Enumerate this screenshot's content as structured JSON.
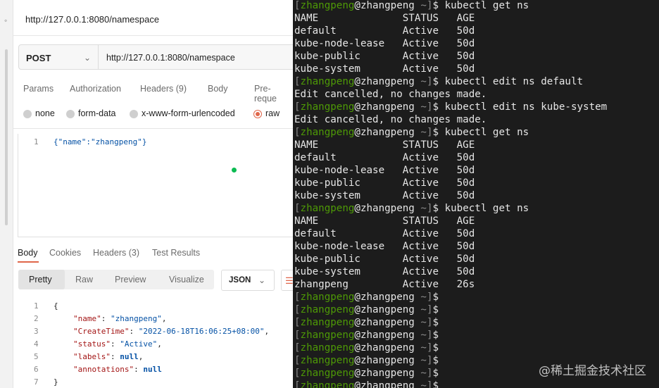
{
  "request": {
    "title": "http://127.0.0.1:8080/namespace",
    "method": "POST",
    "url": "http://127.0.0.1:8080/namespace",
    "tabs": {
      "params": "Params",
      "authorization": "Authorization",
      "headers": "Headers",
      "headers_count": "(9)",
      "body": "Body",
      "prerequest": "Pre-reque"
    },
    "body_types": [
      "none",
      "form-data",
      "x-www-form-urlencoded",
      "raw"
    ],
    "body_line": "1",
    "body_text": "{\"name\":\"zhangpeng\"}"
  },
  "response": {
    "tabs": {
      "body": "Body",
      "cookies": "Cookies",
      "headers": "Headers",
      "headers_count": "(3)",
      "tests": "Test Results"
    },
    "views": [
      "Pretty",
      "Raw",
      "Preview",
      "Visualize"
    ],
    "format": "JSON",
    "lines": [
      "1",
      "2",
      "3",
      "4",
      "5",
      "6",
      "7"
    ],
    "json": {
      "open": "{",
      "name_key": "\"name\"",
      "name_val": "\"zhangpeng\"",
      "create_key": "\"CreateTime\"",
      "create_val": "\"2022-06-18T16:06:25+08:00\"",
      "status_key": "\"status\"",
      "status_val": "\"Active\"",
      "labels_key": "\"labels\"",
      "labels_val": "null",
      "ann_key": "\"annotations\"",
      "ann_val": "null",
      "close": "}"
    }
  },
  "terminal": {
    "user": "zhangpeng",
    "host": "zhangpeng",
    "cwd": "~",
    "lines": [
      {
        "type": "prompt",
        "cmd": "kubectl get ns"
      },
      {
        "type": "out",
        "text": "NAME              STATUS   AGE"
      },
      {
        "type": "out",
        "text": "default           Active   50d"
      },
      {
        "type": "out",
        "text": "kube-node-lease   Active   50d"
      },
      {
        "type": "out",
        "text": "kube-public       Active   50d"
      },
      {
        "type": "out",
        "text": "kube-system       Active   50d"
      },
      {
        "type": "prompt",
        "cmd": "kubectl edit ns default"
      },
      {
        "type": "out",
        "text": "Edit cancelled, no changes made."
      },
      {
        "type": "prompt",
        "cmd": "kubectl edit ns kube-system"
      },
      {
        "type": "out",
        "text": "Edit cancelled, no changes made."
      },
      {
        "type": "prompt",
        "cmd": "kubectl get ns"
      },
      {
        "type": "out",
        "text": "NAME              STATUS   AGE"
      },
      {
        "type": "out",
        "text": "default           Active   50d"
      },
      {
        "type": "out",
        "text": "kube-node-lease   Active   50d"
      },
      {
        "type": "out",
        "text": "kube-public       Active   50d"
      },
      {
        "type": "out",
        "text": "kube-system       Active   50d"
      },
      {
        "type": "prompt",
        "cmd": "kubectl get ns"
      },
      {
        "type": "out",
        "text": "NAME              STATUS   AGE"
      },
      {
        "type": "out",
        "text": "default           Active   50d"
      },
      {
        "type": "out",
        "text": "kube-node-lease   Active   50d"
      },
      {
        "type": "out",
        "text": "kube-public       Active   50d"
      },
      {
        "type": "out",
        "text": "kube-system       Active   50d"
      },
      {
        "type": "out",
        "text": "zhangpeng         Active   26s"
      },
      {
        "type": "prompt",
        "cmd": ""
      },
      {
        "type": "prompt",
        "cmd": ""
      },
      {
        "type": "prompt",
        "cmd": ""
      },
      {
        "type": "prompt",
        "cmd": ""
      },
      {
        "type": "prompt",
        "cmd": ""
      },
      {
        "type": "prompt",
        "cmd": ""
      },
      {
        "type": "prompt",
        "cmd": ""
      },
      {
        "type": "prompt",
        "cmd": ""
      }
    ]
  },
  "watermark": "@稀土掘金技术社区",
  "icons": {
    "gutter": "info-icon",
    "method_chevron": "chevron-down-icon",
    "format_chevron": "chevron-down-icon",
    "wrap": "wrap-lines-icon"
  },
  "colors": {
    "accent": "#e0664a",
    "success": "#0cbb52",
    "terminal_bg": "#1c1c1c",
    "terminal_user": "#4e9a06"
  }
}
